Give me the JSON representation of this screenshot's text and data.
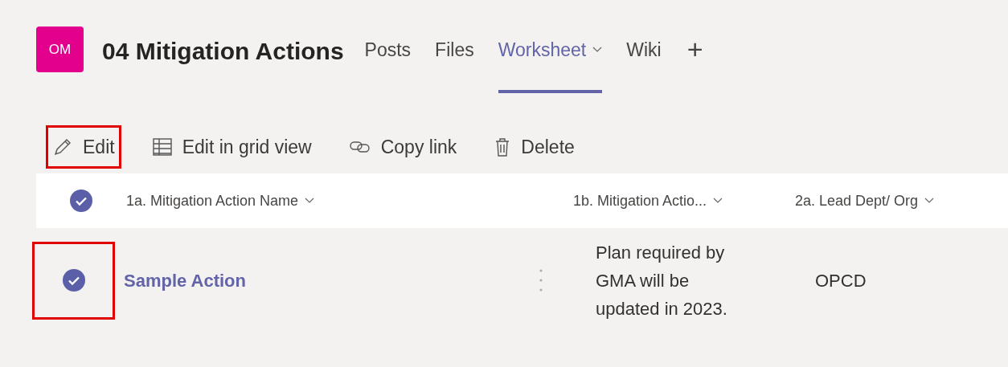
{
  "channel": {
    "avatar": "OM",
    "title": "04 Mitigation Actions"
  },
  "tabs": [
    {
      "label": "Posts",
      "selected": false,
      "dropdown": false
    },
    {
      "label": "Files",
      "selected": false,
      "dropdown": false
    },
    {
      "label": "Worksheet",
      "selected": true,
      "dropdown": true
    },
    {
      "label": "Wiki",
      "selected": false,
      "dropdown": false
    }
  ],
  "add_tab": "+",
  "toolbar": [
    {
      "kind": "edit",
      "label": "Edit",
      "highlighted": true
    },
    {
      "kind": "grid",
      "label": "Edit in grid view",
      "highlighted": false
    },
    {
      "kind": "link",
      "label": "Copy link",
      "highlighted": false
    },
    {
      "kind": "delete",
      "label": "Delete",
      "highlighted": false
    }
  ],
  "table": {
    "all_selected": true,
    "columns": [
      "1a. Mitigation Action Name",
      "1b. Mitigation Actio...",
      "2a. Lead Dept/ Org"
    ],
    "rows": [
      {
        "selected": true,
        "highlighted": true,
        "cells": [
          "Sample Action",
          "Plan required by GMA will be updated in 2023.",
          "OPCD"
        ]
      }
    ]
  }
}
